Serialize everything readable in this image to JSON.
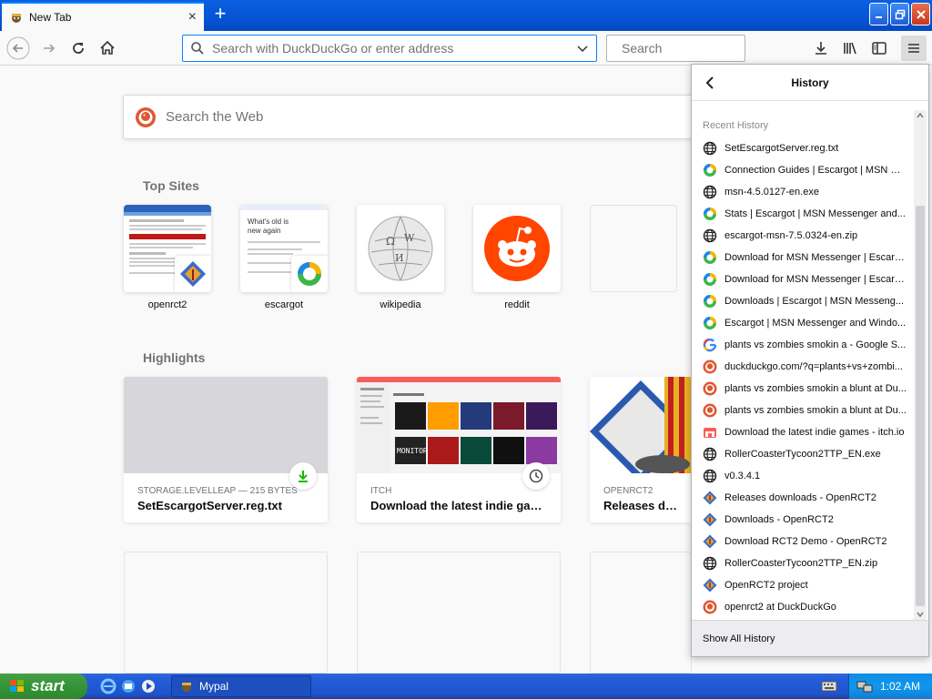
{
  "browser": {
    "tab_title": "New Tab",
    "tab_close": "×",
    "new_tab": "+",
    "urlbar_placeholder": "Search with DuckDuckGo or enter address",
    "searchbar_placeholder": "Search"
  },
  "newtab": {
    "websearch_placeholder": "Search the Web",
    "top_sites_title": "Top Sites",
    "top_sites": [
      {
        "label": "openrct2"
      },
      {
        "label": "escargot"
      },
      {
        "label": "wikipedia"
      },
      {
        "label": "reddit"
      }
    ],
    "escargot_thumb_text": "What's old is new again",
    "highlights_title": "Highlights",
    "highlights": [
      {
        "source": "STORAGE.LEVELLEAP — 215 BYTES",
        "title": "SetEscargotServer.reg.txt"
      },
      {
        "source": "ITCH",
        "title": "Download the latest indie games..."
      },
      {
        "source": "OPENRCT2",
        "title": "Releases downloa"
      }
    ]
  },
  "history_panel": {
    "title": "History",
    "recent_label": "Recent History",
    "footer": "Show All History",
    "items": [
      {
        "icon": "globe-icon",
        "text": "SetEscargotServer.reg.txt"
      },
      {
        "icon": "escargot-icon",
        "text": "Connection Guides | Escargot | MSN M..."
      },
      {
        "icon": "globe-icon",
        "text": "msn-4.5.0127-en.exe"
      },
      {
        "icon": "escargot-icon",
        "text": "Stats | Escargot | MSN Messenger and..."
      },
      {
        "icon": "globe-icon",
        "text": "escargot-msn-7.5.0324-en.zip"
      },
      {
        "icon": "escargot-icon",
        "text": "Download for MSN Messenger | Escarg..."
      },
      {
        "icon": "escargot-icon",
        "text": "Download for MSN Messenger | Escarg..."
      },
      {
        "icon": "escargot-icon",
        "text": "Downloads | Escargot | MSN Messeng..."
      },
      {
        "icon": "escargot-icon",
        "text": "Escargot | MSN Messenger and Windo..."
      },
      {
        "icon": "google-icon",
        "text": "plants vs zombies smokin a - Google S..."
      },
      {
        "icon": "duckduckgo-icon",
        "text": "duckduckgo.com/?q=plants+vs+zombi..."
      },
      {
        "icon": "duckduckgo-icon",
        "text": "plants vs zombies smokin a blunt at Du..."
      },
      {
        "icon": "duckduckgo-icon",
        "text": "plants vs zombies smokin a blunt at Du..."
      },
      {
        "icon": "itch-icon",
        "text": "Download the latest indie games - itch.io"
      },
      {
        "icon": "globe-icon",
        "text": "RollerCoasterTycoon2TTP_EN.exe"
      },
      {
        "icon": "globe-icon",
        "text": "v0.3.4.1"
      },
      {
        "icon": "openrct2-icon",
        "text": "Releases downloads - OpenRCT2"
      },
      {
        "icon": "openrct2-icon",
        "text": "Downloads - OpenRCT2"
      },
      {
        "icon": "openrct2-icon",
        "text": "Download RCT2 Demo - OpenRCT2"
      },
      {
        "icon": "globe-icon",
        "text": "RollerCoasterTycoon2TTP_EN.zip"
      },
      {
        "icon": "openrct2-icon",
        "text": "OpenRCT2 project"
      },
      {
        "icon": "duckduckgo-icon",
        "text": "openrct2 at DuckDuckGo"
      }
    ]
  },
  "taskbar": {
    "start_label": "start",
    "task_label": "Mypal",
    "clock": "1:02 AM"
  },
  "colors": {
    "accent": "#0a84ff",
    "taskbar": "#245ddb",
    "start": "#37953a"
  }
}
